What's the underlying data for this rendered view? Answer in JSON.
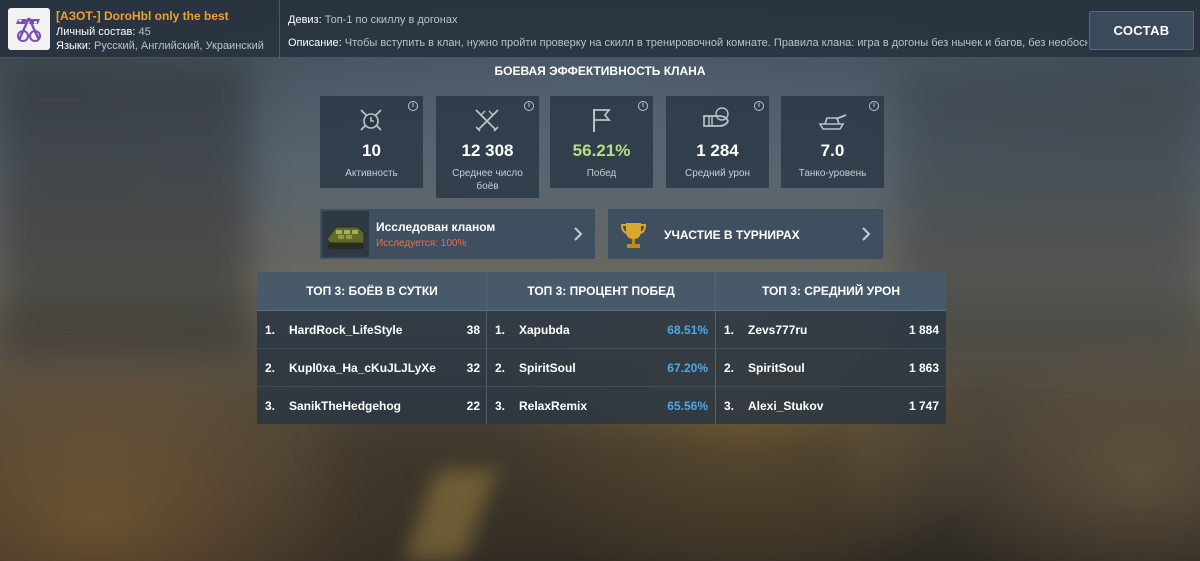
{
  "clan": {
    "name": "[АЗОТ-] DoroHbl only the best",
    "members_label": "Личный состав:",
    "members_value": "45",
    "languages_label": "Языки:",
    "languages_value": "Русский, Английский, Украинский"
  },
  "motto": {
    "label": "Девиз:",
    "value": "Топ-1 по скиллу в догонах"
  },
  "description": {
    "label": "Описание:",
    "value": "Чтобы вступить в клан, нужно пройти проверку на скилл в тренировочной комнате. Правила клана: игра в догоны без нычек и багов, без необоснованной..."
  },
  "roster_button": "СОСТАВ",
  "section_title": "БОЕВАЯ ЭФФЕКТИВНОСТЬ КЛАНА",
  "stats": [
    {
      "value": "10",
      "label": "Активность",
      "icon": "activity-icon"
    },
    {
      "value": "12 308",
      "label": "Среднее число боёв",
      "icon": "battles-icon"
    },
    {
      "value": "56.21%",
      "label": "Побед",
      "icon": "victory-flag-icon"
    },
    {
      "value": "1 284",
      "label": "Средний урон",
      "icon": "damage-shell-icon"
    },
    {
      "value": "7.0",
      "label": "Танко-уровень",
      "icon": "tank-icon"
    }
  ],
  "research": {
    "title": "Исследован кланом",
    "subtitle": "Исследуется: 100%"
  },
  "tournaments": {
    "title": "УЧАСТИЕ В ТУРНИРАХ"
  },
  "tables": [
    {
      "title": "ТОП 3: БОЁВ В СУТКИ",
      "rows": [
        {
          "rank": "1.",
          "name": "HardRock_LifeStyle",
          "value": "38"
        },
        {
          "rank": "2.",
          "name": "Kupl0xa_Ha_cKuJLJLyXe",
          "value": "32"
        },
        {
          "rank": "3.",
          "name": "SanikTheHedgehog",
          "value": "22"
        }
      ]
    },
    {
      "title": "ТОП 3: ПРОЦЕНТ ПОБЕД",
      "rows": [
        {
          "rank": "1.",
          "name": "Xapubda",
          "value": "68.51%"
        },
        {
          "rank": "2.",
          "name": "SpiritSoul",
          "value": "67.20%"
        },
        {
          "rank": "3.",
          "name": "RelaxRemix",
          "value": "65.56%"
        }
      ]
    },
    {
      "title": "ТОП 3: СРЕДНИЙ УРОН",
      "rows": [
        {
          "rank": "1.",
          "name": "Zevs777ru",
          "value": "1 884"
        },
        {
          "rank": "2.",
          "name": "SpiritSoul",
          "value": "1 863"
        },
        {
          "rank": "3.",
          "name": "Alexi_Stukov",
          "value": "1 747"
        }
      ]
    }
  ],
  "colors": {
    "clan_name": "#f0a030",
    "win_rate": "#b8df86",
    "percent_blue": "#4ea7e8",
    "research_orange": "#f26b4a"
  }
}
